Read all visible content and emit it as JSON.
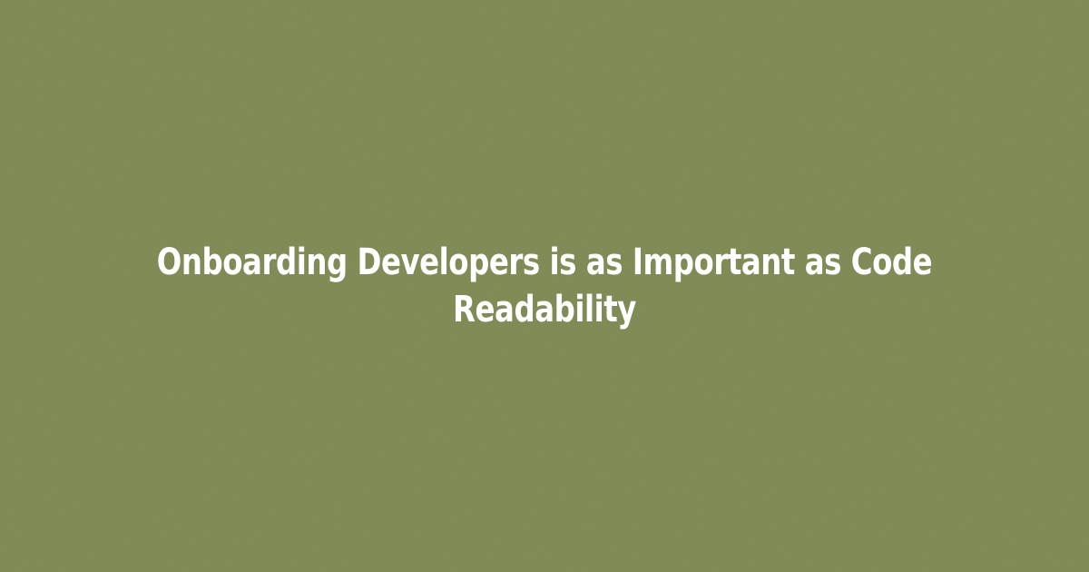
{
  "background": {
    "color": "#7a8650",
    "texture": "paper-noise"
  },
  "title": {
    "text": "Onboarding Developers is as Important as Code Readability",
    "color": "#ffffff"
  }
}
